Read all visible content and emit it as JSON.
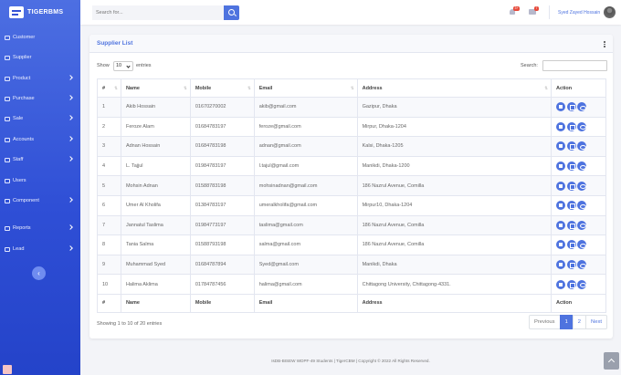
{
  "brand": {
    "name": "TIGERBMS"
  },
  "sidebar": {
    "items": [
      {
        "label": "Customer",
        "has_arrow": false
      },
      {
        "label": "Supplier",
        "has_arrow": false
      },
      {
        "label": "Product",
        "has_arrow": true
      },
      {
        "label": "Purchase",
        "has_arrow": true
      },
      {
        "label": "Sale",
        "has_arrow": true
      },
      {
        "label": "Accounts",
        "has_arrow": true
      },
      {
        "label": "Staff",
        "has_arrow": true
      },
      {
        "label": "Users",
        "has_arrow": false
      },
      {
        "label": "Component",
        "has_arrow": true
      },
      {
        "label": "Reports",
        "has_arrow": true
      },
      {
        "label": "Lead",
        "has_arrow": true
      }
    ],
    "collapse_glyph": "‹"
  },
  "topbar": {
    "search_placeholder": "Search for...",
    "alerts_badge": "3+",
    "messages_badge": "7",
    "user_name": "Syed Zayed Hossain"
  },
  "card": {
    "title": "Supplier List"
  },
  "table_controls": {
    "show_label": "Show",
    "entries_value": "10",
    "entries_label": "entries",
    "search_label": "Search:"
  },
  "table": {
    "headers": [
      "#",
      "Name",
      "Mobile",
      "Email",
      "Address",
      "Action"
    ],
    "rows": [
      [
        "1",
        "Akib Hossain",
        "01670270002",
        "akib@gmail.com",
        "Gazipur, Dhaka"
      ],
      [
        "2",
        "Feroze Alam",
        "01684783197",
        "feroze@gmail.com",
        "Mirpur, Dhaka-1204"
      ],
      [
        "3",
        "Adnan Hossain",
        "01684783198",
        "adnan@gmail.com",
        "Kalsi, Dhaka-1205"
      ],
      [
        "4",
        "L. Tajjul",
        "01984783197",
        "l.tajul@gmail.com",
        "Manikdi, Dhaka-1200"
      ],
      [
        "5",
        "Mohsin Adnan",
        "01588783198",
        "mohsinadnan@gmail.com",
        "186 Nazrul Avenue, Comilla"
      ],
      [
        "6",
        "Umer Al Kholifa",
        "01384783197",
        "umeralkholifa@gmail.com",
        "Mirpur10, Dhaka-1204"
      ],
      [
        "7",
        "Jannatul Taslima",
        "01984773197",
        "taslima@gmail.com",
        "186 Nazrul Avenue, Comilla"
      ],
      [
        "8",
        "Tania Salma",
        "01588793198",
        "salma@gmail.com",
        "186 Nazrul Avenue, Comilla"
      ],
      [
        "9",
        "Muhammad Syed",
        "01684787894",
        "Syed@gmail.com",
        "Manikdi, Dhaka"
      ],
      [
        "10",
        "Halima Aklima",
        "01784787456",
        "halima@gmail.com",
        "Chittagong University, Chittagong-4331."
      ]
    ]
  },
  "pagination": {
    "info": "Showing 1 to 10 of 20 entries",
    "previous": "Previous",
    "pages": [
      "1",
      "2"
    ],
    "next": "Next"
  },
  "footer": {
    "text": "IsDB-BISEW WDPF-49 Students | TigerCBM | Copyright © 2022 All Rights Reserved."
  },
  "colors": {
    "primary": "#4e73df",
    "sidebar_top": "#4d6fe2",
    "sidebar_bottom": "#2443c9",
    "badge": "#e74a3b"
  }
}
